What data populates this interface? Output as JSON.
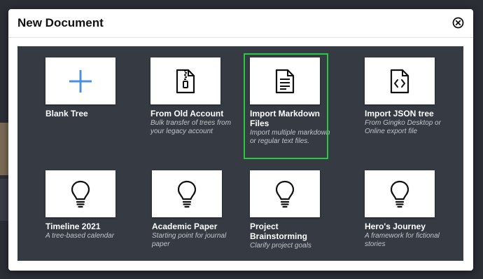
{
  "modal": {
    "title": "New Document",
    "close_icon": "close-circle-icon"
  },
  "templates": [
    {
      "title": "Blank Tree",
      "description": "",
      "icon": "plus-icon"
    },
    {
      "title": "From Old Account",
      "description": "Bulk transfer of trees from your legacy account",
      "icon": "zip-file-icon"
    },
    {
      "title": "Import Markdown Files",
      "description": "Import multiple markdown or regular text files.",
      "icon": "text-file-icon",
      "selected": true
    },
    {
      "title": "Import JSON tree",
      "description": "From Gingko Desktop or Online export file",
      "icon": "code-file-icon"
    },
    {
      "title": "Timeline 2021",
      "description": "A tree-based calendar",
      "icon": "lightbulb-icon"
    },
    {
      "title": "Academic Paper",
      "description": "Starting point for journal paper",
      "icon": "lightbulb-icon"
    },
    {
      "title": "Project Brainstorming",
      "description": "Clarify project goals",
      "icon": "lightbulb-icon"
    },
    {
      "title": "Hero's Journey",
      "description": "A framework for fictional stories",
      "icon": "lightbulb-icon"
    }
  ],
  "colors": {
    "grid_background": "#353a43",
    "selected_border": "#27c93f",
    "plus_icon": "#4a90e2"
  }
}
